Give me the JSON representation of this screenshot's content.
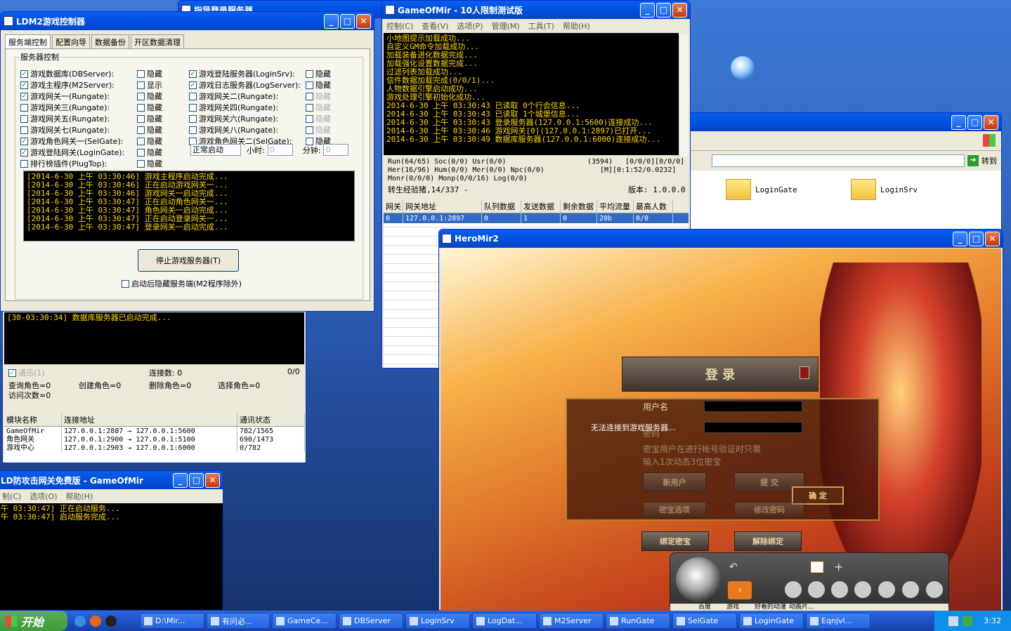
{
  "game_of_mir": {
    "title": "GameOfMir - 10人限制测试版",
    "menu": [
      "控制(C)",
      "查看(V)",
      "选项(P)",
      "管理(M)",
      "工具(T)",
      "帮助(H)"
    ],
    "log": "小地图提示加载成功...\n自定义GM命令加载成功...\n加载装备进化数据完成...\n加载强化设置数据完成...\n过滤列表加载成功...\n信件数据加载完成(0/0/1)...\n人物数据引擎启动成功...\n游戏处理引擎初始化成功...\n2014-6-30 上午 03:30:43 已读取 0个行会信息...\n2014-6-30 上午 03:30:43 已读取 1个城堡信息...\n2014-6-30 上午 03:30:43 登录服务器(127.0.0.1:5600)连接成功...\n2014-6-30 上午 03:30:46 游戏网关[0](127.0.0.1:2897)已打开...\n2014-6-30 上午 03:30:49 数据库服务器(127.0.0.1:6000)连接成功...",
    "stats": [
      "Run(64/65) Soc(0/0) Usr(0/0)",
      "(3594)",
      "[0/0/0][0/0/0]",
      "Her(16/96) Hum(0/0) Mer(0/0) Npc(0/0)",
      "[M][0:1:52/0.0232]",
      "Monr(0/0/0) Monp(0/0/16) Log(0/0)",
      "转生经验猪,14/337 -",
      "版本: 1.0.0.0"
    ],
    "grid_headers": [
      "网关",
      "网关地址",
      "队列数据",
      "发送数据",
      "剩余数据",
      "平均流量",
      "最高人数"
    ],
    "grid_row": [
      "0",
      "127.0.0.1:2897",
      "0",
      "1",
      "0",
      "20b",
      "0/0"
    ]
  },
  "ldm2": {
    "title": "LDM2游戏控制器",
    "tabs": [
      "服务端控制",
      "配置向导",
      "数据备份",
      "开区数据清理"
    ],
    "group": "服务器控制",
    "left_items": [
      {
        "label": "游戏数据库(DBServer):",
        "checked": "✓",
        "opt": "隐藏"
      },
      {
        "label": "游戏主程序(M2Server):",
        "checked": "✓",
        "opt": "显示"
      },
      {
        "label": "游戏网关一(Rungate):",
        "checked": "✓",
        "opt": "隐藏"
      },
      {
        "label": "游戏网关三(Rungate):",
        "checked": "",
        "opt": "隐藏"
      },
      {
        "label": "游戏网关五(Rungate):",
        "checked": "",
        "opt": "隐藏"
      },
      {
        "label": "游戏网关七(Rungate):",
        "checked": "",
        "opt": "隐藏"
      },
      {
        "label": "游戏角色网关一(SelGate):",
        "checked": "✓",
        "opt": "隐藏"
      },
      {
        "label": "游戏登陆网关(LoginGate):",
        "checked": "✓",
        "opt": "隐藏"
      },
      {
        "label": "排行榜插件(PlugTop):",
        "checked": "",
        "opt": "隐藏"
      }
    ],
    "right_items": [
      {
        "label": "游戏登陆服务器(LoginSrv):",
        "checked": "✓",
        "opt": "隐藏"
      },
      {
        "label": "游戏日志服务器(LogServer):",
        "checked": "✓",
        "opt": "隐藏"
      },
      {
        "label": "游戏网关二(Rungate):",
        "checked": "",
        "opt": "隐藏"
      },
      {
        "label": "游戏网关四(Rungate):",
        "checked": "",
        "opt": "隐藏"
      },
      {
        "label": "游戏网关六(Rungate):",
        "checked": "",
        "opt": "隐藏"
      },
      {
        "label": "游戏网关八(Rungate):",
        "checked": "",
        "opt": "隐藏"
      },
      {
        "label": "游戏角色网关二(SelGate):",
        "checked": "",
        "opt": "隐藏"
      }
    ],
    "mode": "正常启动",
    "hour_label": "小时:",
    "hour": "0",
    "min_label": "分钟:",
    "min": "0",
    "log": "[2014-6-30 上午 03:30:46] 游戏主程序启动完成...\n[2014-6-30 上午 03:30:46] 正在启动游戏网关一...\n[2014-6-30 上午 03:30:46] 游戏网关一启动完成...\n[2014-6-30 上午 03:30:47] 正在启动角色网关一...\n[2014-6-30 上午 03:30:47] 角色网关一启动完成...\n[2014-6-30 上午 03:30:47] 正在启动登录网关一...\n[2014-6-30 上午 03:30:47] 登录网关一启动完成...",
    "stop_button": "停止游戏服务器(T)",
    "hide_option": "启动后隐藏服务端(M2程序除外)"
  },
  "dbserver": {
    "log": "[30-03:30:34] 数据库服务器已启动完成...",
    "comm": "通迅(1)",
    "conn": "连接数: 0",
    "ratio": "0/0",
    "counts": [
      "查询角色=0",
      "创建角色=0",
      "删除角色=0",
      "选择角色=0",
      "访问次数=0"
    ],
    "headers": [
      "模块名称",
      "连接地址",
      "通讯状态"
    ],
    "rows": [
      [
        "GameOfMir",
        "127.0.0.1:2887 → 127.0.0.1:5600",
        "782/1565"
      ],
      [
        "角色网关",
        "127.0.0.1:2900 → 127.0.0.1:5100",
        "690/1473"
      ],
      [
        "游戏中心",
        "127.0.0.1:2903 → 127.0.0.1:6000",
        "0/782"
      ]
    ]
  },
  "ld_gate": {
    "title": "LD防攻击网关免费版 - GameOfMir",
    "menu": [
      "制(C)",
      "选项(O)",
      "帮助(H)"
    ],
    "log": "午 03:30:47] 正在启动服务...\n午 03:30:47] 启动服务完成..."
  },
  "explorer": {
    "go_label": "转到",
    "folders": [
      "LoginGate",
      "LoginSrv"
    ]
  },
  "behind_title": "指导登录服务器",
  "heromir": {
    "title": "HeroMir2",
    "login_title": "登 录",
    "user_label": "用户名",
    "error": "无法连接到游戏服务器...",
    "pwd_label": "密码",
    "note1": "密宝用户在进行帐号验证时只需",
    "note2": "输入1次动态3位密宝",
    "btn_new": "新用户",
    "btn_submit": "提 交",
    "btn_ok": "确 定",
    "btn_opt": "密宝选项",
    "btn_change": "修改密码",
    "btn_bind": "绑定密宝",
    "btn_unbind": "解除绑定"
  },
  "dock": {
    "bar_items": [
      "百度",
      "游戏",
      "好看的动漫",
      "动画片..."
    ]
  },
  "taskbar": {
    "start": "开始",
    "tasks": [
      "D:\\Mir...",
      "有问必...",
      "GameCe...",
      "DBServer",
      "LoginSrv",
      "LogDat...",
      "M2Server",
      "RunGate",
      "SelGate",
      "LoginGate",
      "Eqnjvl..."
    ],
    "clock": "3:32"
  }
}
